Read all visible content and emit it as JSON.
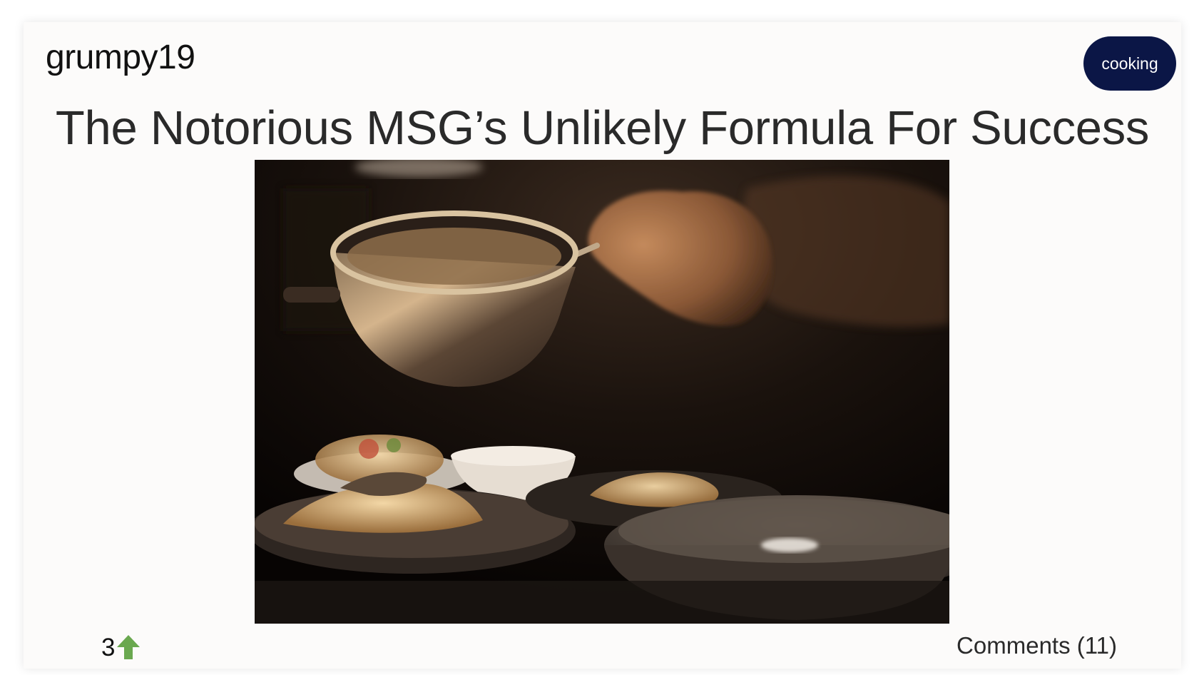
{
  "post": {
    "username": "grumpy19",
    "tag": "cooking",
    "title": "The Notorious MSG’s Unlikely Formula For Success",
    "image_alt": "Chef's hand pouring from a metal pot over plated dishes in a dark kitchen",
    "votes": "3",
    "comments_label": "Comments (11)"
  },
  "colors": {
    "tag_background": "#0b1646",
    "upvote_arrow": "#6aa84f",
    "card_background": "#fcfbfa"
  },
  "icons": {
    "upvote": "arrow-up-icon"
  }
}
